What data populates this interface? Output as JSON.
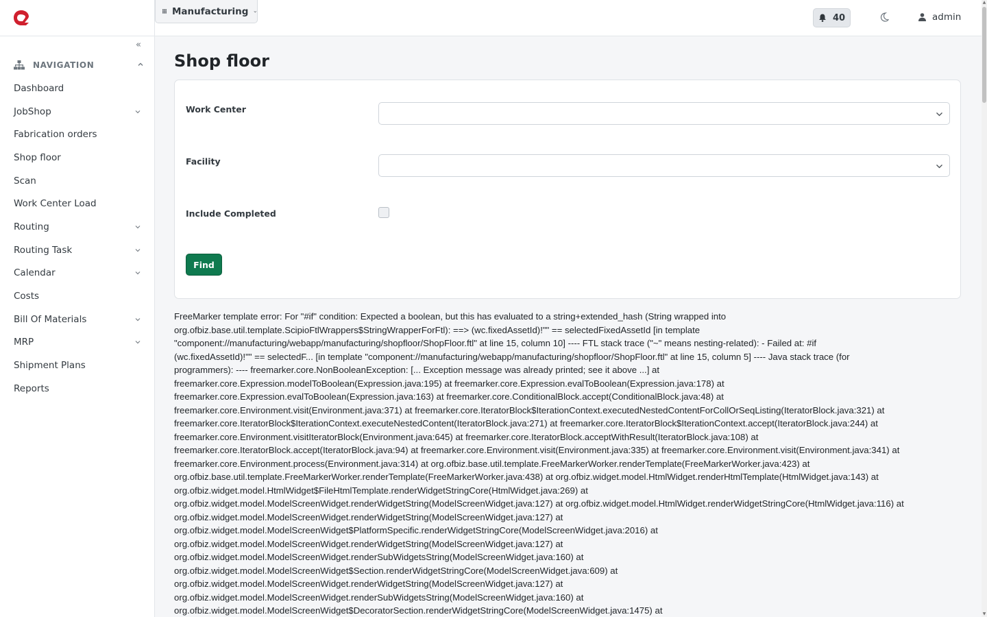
{
  "topbar": {
    "app_name": "Manufacturing",
    "notification_count": "40",
    "user_name": "admin"
  },
  "sidebar": {
    "section_label": "NAVIGATION",
    "items": [
      {
        "label": "Dashboard",
        "has_submenu": false
      },
      {
        "label": "JobShop",
        "has_submenu": true
      },
      {
        "label": "Fabrication orders",
        "has_submenu": false
      },
      {
        "label": "Shop floor",
        "has_submenu": false
      },
      {
        "label": "Scan",
        "has_submenu": false
      },
      {
        "label": "Work Center Load",
        "has_submenu": false
      },
      {
        "label": "Routing",
        "has_submenu": true
      },
      {
        "label": "Routing Task",
        "has_submenu": true
      },
      {
        "label": "Calendar",
        "has_submenu": true
      },
      {
        "label": "Costs",
        "has_submenu": false
      },
      {
        "label": "Bill Of Materials",
        "has_submenu": true
      },
      {
        "label": "MRP",
        "has_submenu": true
      },
      {
        "label": "Shipment Plans",
        "has_submenu": false
      },
      {
        "label": "Reports",
        "has_submenu": false
      }
    ]
  },
  "main": {
    "page_title": "Shop floor",
    "form": {
      "work_center_label": "Work Center",
      "work_center_value": "",
      "facility_label": "Facility",
      "facility_value": "",
      "include_completed_label": "Include Completed",
      "include_completed_checked": false,
      "find_button": "Find"
    },
    "error_lines": [
      "FreeMarker template error: For \"#if\" condition: Expected a boolean, but this has evaluated to a string+extended_hash (String wrapped into",
      "org.ofbiz.base.util.template.ScipioFtlWrappers$StringWrapperForFtl): ==> (wc.fixedAssetId)!\"\" == selectedFixedAssetId [in template",
      "\"component://manufacturing/webapp/manufacturing/shopfloor/ShopFloor.ftl\" at line 15, column 10] ---- FTL stack trace (\"~\" means nesting-related): - Failed at: #if",
      "(wc.fixedAssetId)!\"\" == selectedF... [in template \"component://manufacturing/webapp/manufacturing/shopfloor/ShopFloor.ftl\" at line 15, column 5] ---- Java stack trace (for",
      "programmers): ---- freemarker.core.NonBooleanException: [... Exception message was already printed; see it above ...] at",
      "freemarker.core.Expression.modelToBoolean(Expression.java:195) at freemarker.core.Expression.evalToBoolean(Expression.java:178) at",
      "freemarker.core.Expression.evalToBoolean(Expression.java:163) at freemarker.core.ConditionalBlock.accept(ConditionalBlock.java:48) at",
      "freemarker.core.Environment.visit(Environment.java:371) at freemarker.core.IteratorBlock$IterationContext.executedNestedContentForCollOrSeqListing(IteratorBlock.java:321) at",
      "freemarker.core.IteratorBlock$IterationContext.executeNestedContent(IteratorBlock.java:271) at freemarker.core.IteratorBlock$IterationContext.accept(IteratorBlock.java:244) at",
      "freemarker.core.Environment.visitIteratorBlock(Environment.java:645) at freemarker.core.IteratorBlock.acceptWithResult(IteratorBlock.java:108) at",
      "freemarker.core.IteratorBlock.accept(IteratorBlock.java:94) at freemarker.core.Environment.visit(Environment.java:335) at freemarker.core.Environment.visit(Environment.java:341) at",
      "freemarker.core.Environment.process(Environment.java:314) at org.ofbiz.base.util.template.FreeMarkerWorker.renderTemplate(FreeMarkerWorker.java:423) at",
      "org.ofbiz.base.util.template.FreeMarkerWorker.renderTemplate(FreeMarkerWorker.java:438) at org.ofbiz.widget.model.HtmlWidget.renderHtmlTemplate(HtmlWidget.java:143) at",
      "org.ofbiz.widget.model.HtmlWidget$FileHtmlTemplate.renderWidgetStringCore(HtmlWidget.java:269) at",
      "org.ofbiz.widget.model.ModelScreenWidget.renderWidgetString(ModelScreenWidget.java:127) at org.ofbiz.widget.model.HtmlWidget.renderWidgetStringCore(HtmlWidget.java:116) at",
      "org.ofbiz.widget.model.ModelScreenWidget.renderWidgetString(ModelScreenWidget.java:127) at",
      "org.ofbiz.widget.model.ModelScreenWidget$PlatformSpecific.renderWidgetStringCore(ModelScreenWidget.java:2016) at",
      "org.ofbiz.widget.model.ModelScreenWidget.renderWidgetString(ModelScreenWidget.java:127) at",
      "org.ofbiz.widget.model.ModelScreenWidget.renderSubWidgetsString(ModelScreenWidget.java:160) at",
      "org.ofbiz.widget.model.ModelScreenWidget$Section.renderWidgetStringCore(ModelScreenWidget.java:609) at",
      "org.ofbiz.widget.model.ModelScreenWidget.renderWidgetString(ModelScreenWidget.java:127) at",
      "org.ofbiz.widget.model.ModelScreenWidget.renderSubWidgetsString(ModelScreenWidget.java:160) at",
      "org.ofbiz.widget.model.ModelScreenWidget$DecoratorSection.renderWidgetStringCore(ModelScreenWidget.java:1475) at"
    ]
  },
  "colors": {
    "logo_red": "#d0202e",
    "primary_green": "#0f7a4f",
    "sidebar_bg": "#ffffff",
    "page_bg": "#f5f6f8"
  },
  "icons": {
    "logo": "brand-logo-icon",
    "collapse": "double-chevron-left-icon",
    "nav_header": "sitemap-icon",
    "app_switcher": "grid-icon",
    "notifications": "bell-icon",
    "theme": "moon-icon",
    "user": "user-icon"
  }
}
